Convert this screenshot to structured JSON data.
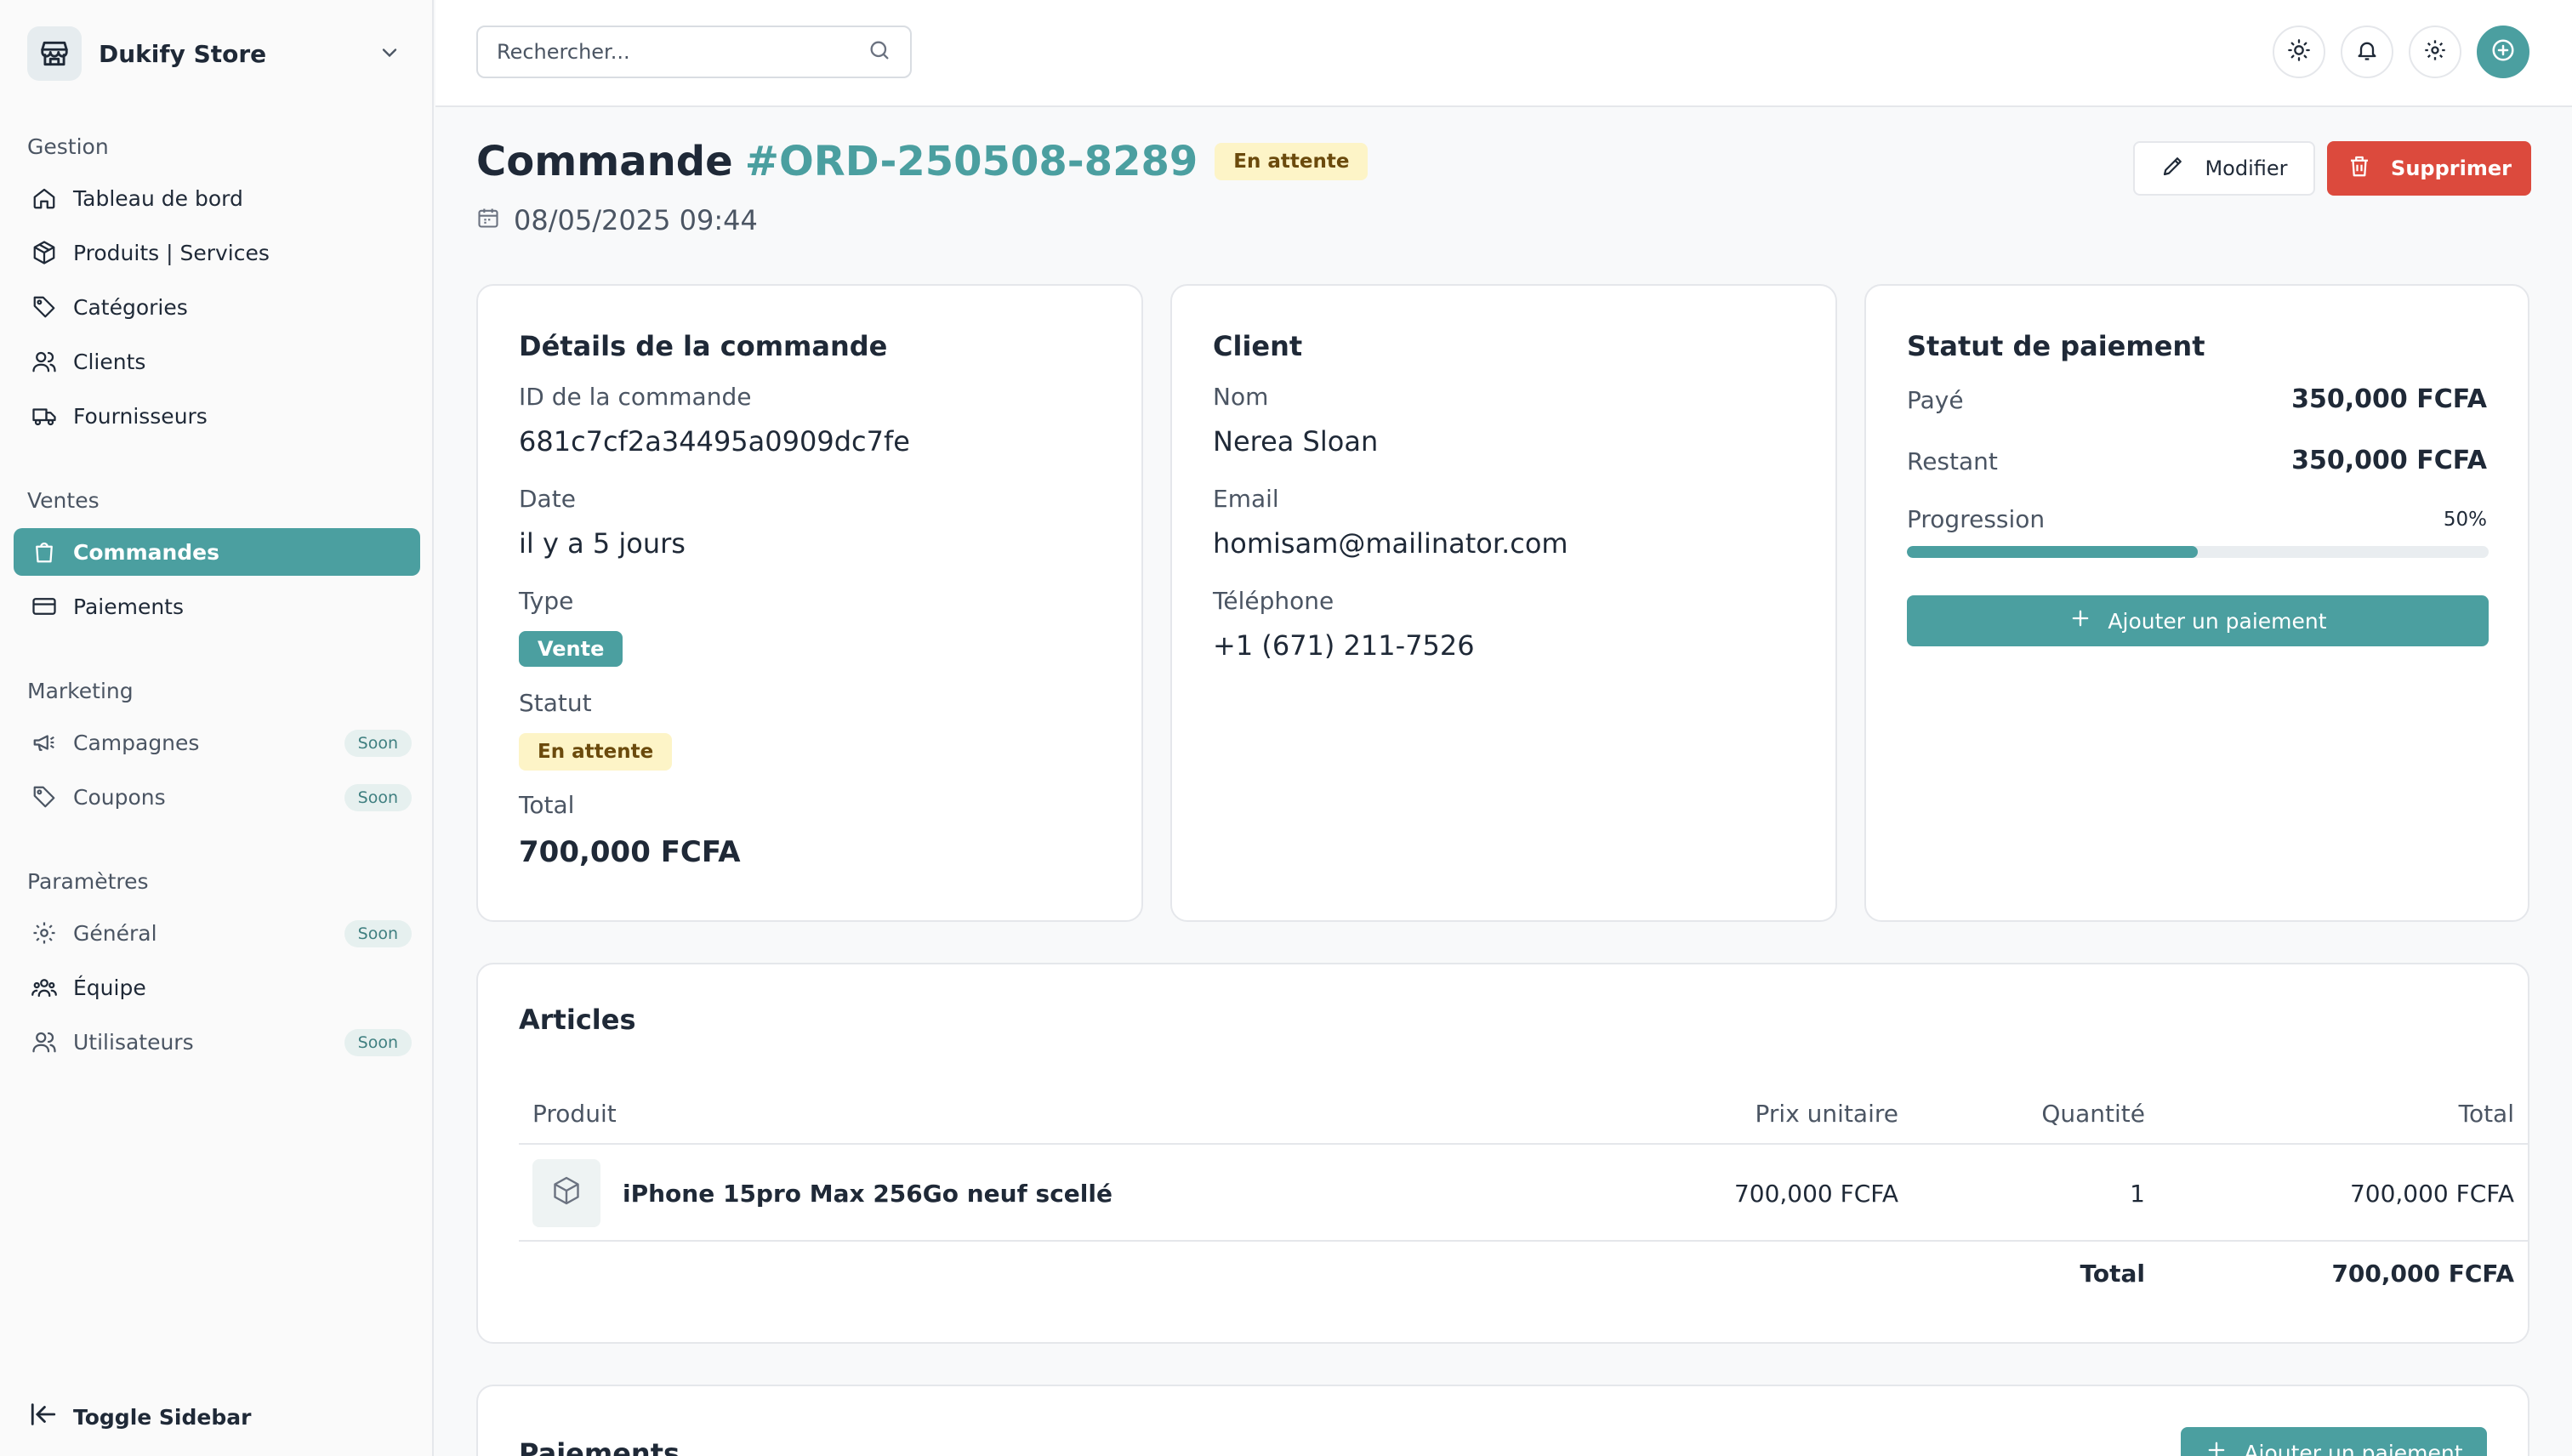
{
  "store": {
    "name": "Dukify Store"
  },
  "sidebar": {
    "groups": [
      {
        "title": "Gestion"
      },
      {
        "title": "Ventes"
      },
      {
        "title": "Marketing"
      },
      {
        "title": "Paramètres"
      }
    ],
    "items": {
      "dashboard": {
        "label": "Tableau de bord",
        "icon": "home-icon"
      },
      "products": {
        "label": "Produits | Services",
        "icon": "box-icon"
      },
      "categories": {
        "label": "Catégories",
        "icon": "tag-icon"
      },
      "clients": {
        "label": "Clients",
        "icon": "users-icon"
      },
      "suppliers": {
        "label": "Fournisseurs",
        "icon": "truck-icon"
      },
      "orders": {
        "label": "Commandes",
        "icon": "shopping-bag-icon",
        "active": true
      },
      "payments": {
        "label": "Paiements",
        "icon": "credit-card-icon"
      },
      "campaigns": {
        "label": "Campagnes",
        "icon": "megaphone-icon",
        "badge": "Soon"
      },
      "coupons": {
        "label": "Coupons",
        "icon": "tag-icon",
        "badge": "Soon"
      },
      "general": {
        "label": "Général",
        "icon": "gear-icon",
        "badge": "Soon"
      },
      "team": {
        "label": "Équipe",
        "icon": "team-icon"
      },
      "users": {
        "label": "Utilisateurs",
        "icon": "users-icon",
        "badge": "Soon"
      }
    },
    "toggle_label": "Toggle Sidebar"
  },
  "topbar": {
    "search_placeholder": "Rechercher..."
  },
  "order": {
    "title_prefix": "Commande",
    "number": "#ORD-250508-8289",
    "status_badge": "En attente",
    "datetime": "08/05/2025 09:44",
    "edit_label": "Modifier",
    "delete_label": "Supprimer"
  },
  "details": {
    "title": "Détails de la commande",
    "id_label": "ID de la commande",
    "id_value": "681c7cf2a34495a0909dc7fe",
    "date_label": "Date",
    "date_value": "il y a 5 jours",
    "type_label": "Type",
    "type_value": "Vente",
    "status_label": "Statut",
    "status_value": "En attente",
    "total_label": "Total",
    "total_value": "700,000 FCFA"
  },
  "client": {
    "title": "Client",
    "name_label": "Nom",
    "name_value": "Nerea Sloan",
    "email_label": "Email",
    "email_value": "homisam@mailinator.com",
    "phone_label": "Téléphone",
    "phone_value": "+1 (671) 211-7526"
  },
  "payment_status": {
    "title": "Statut de paiement",
    "paid_label": "Payé",
    "paid_value": "350,000 FCFA",
    "remaining_label": "Restant",
    "remaining_value": "350,000 FCFA",
    "progress_label": "Progression",
    "progress_text": "50%",
    "progress_fraction": 0.5,
    "add_payment_label": "Ajouter un paiement"
  },
  "articles": {
    "title": "Articles",
    "columns": [
      "Produit",
      "Prix unitaire",
      "Quantité",
      "Total"
    ],
    "rows": [
      {
        "product": "iPhone 15pro Max 256Go neuf scellé",
        "unit_price": "700,000 FCFA",
        "quantity": "1",
        "total": "700,000 FCFA"
      }
    ],
    "footer_label": "Total",
    "footer_value": "700,000 FCFA"
  },
  "payments_section": {
    "title": "Paiements",
    "add_payment_label": "Ajouter un paiement"
  },
  "colors": {
    "accent": "#4b9fa0",
    "danger": "#dc4a3d",
    "pending_bg": "#fdf4c7",
    "pending_text": "#6b4a0c"
  }
}
